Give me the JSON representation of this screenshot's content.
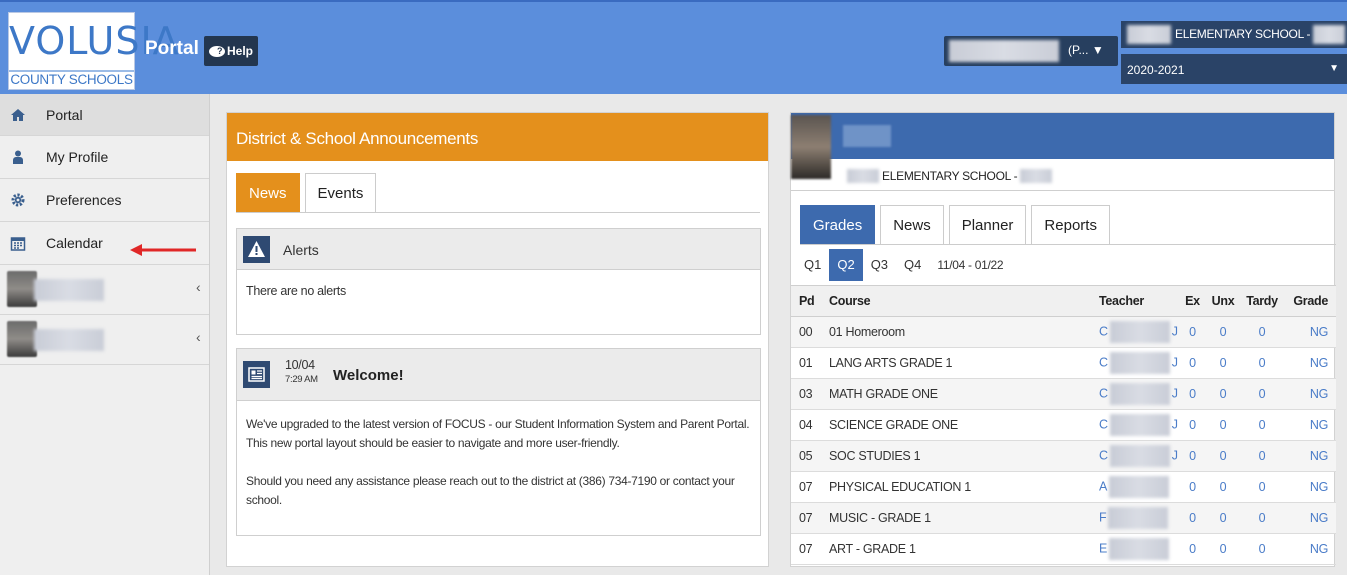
{
  "header": {
    "logo_text": "VOLUSIA",
    "logo_sub": "COUNTY SCHOOLS",
    "title": "Portal",
    "help": "Help",
    "user_select": "(P...",
    "school": "ELEMENTARY SCHOOL -",
    "year": "2020-2021"
  },
  "sidebar": {
    "items": [
      {
        "label": "Portal",
        "icon": "home-icon"
      },
      {
        "label": "My Profile",
        "icon": "user-icon"
      },
      {
        "label": "Preferences",
        "icon": "gear-icon"
      },
      {
        "label": "Calendar",
        "icon": "calendar-icon"
      }
    ]
  },
  "announcements": {
    "title": "District & School Announcements",
    "tabs": [
      "News",
      "Events"
    ],
    "alerts": {
      "title": "Alerts",
      "body": "There are no alerts"
    },
    "welcome": {
      "date": "10/04",
      "time": "7:29 AM",
      "title": "Welcome!",
      "p1": "We've upgraded to the latest version of FOCUS - our Student Information System and Parent Portal.",
      "p2": "This new portal layout should be easier to navigate and more user-friendly.",
      "p3": "Should you need any assistance please reach out to the district at (386) 734-7190 or contact your school."
    }
  },
  "student": {
    "school": "ELEMENTARY SCHOOL -",
    "tabs": [
      "Grades",
      "News",
      "Planner",
      "Reports"
    ],
    "quarters": [
      "Q1",
      "Q2",
      "Q3",
      "Q4"
    ],
    "range": "11/04 - 01/22",
    "columns": {
      "pd": "Pd",
      "course": "Course",
      "teacher": "Teacher",
      "ex": "Ex",
      "unx": "Unx",
      "tardy": "Tardy",
      "grade": "Grade"
    },
    "rows": [
      {
        "pd": "00",
        "course": "01 Homeroom",
        "t1": "C",
        "t2": "J",
        "ex": "0",
        "unx": "0",
        "tardy": "0",
        "grade": "NG"
      },
      {
        "pd": "01",
        "course": "LANG ARTS GRADE 1",
        "t1": "C",
        "t2": "J",
        "ex": "0",
        "unx": "0",
        "tardy": "0",
        "grade": "NG"
      },
      {
        "pd": "03",
        "course": "MATH GRADE ONE",
        "t1": "C",
        "t2": "J",
        "ex": "0",
        "unx": "0",
        "tardy": "0",
        "grade": "NG"
      },
      {
        "pd": "04",
        "course": "SCIENCE GRADE ONE",
        "t1": "C",
        "t2": "J",
        "ex": "0",
        "unx": "0",
        "tardy": "0",
        "grade": "NG"
      },
      {
        "pd": "05",
        "course": "SOC STUDIES 1",
        "t1": "C",
        "t2": "J",
        "ex": "0",
        "unx": "0",
        "tardy": "0",
        "grade": "NG"
      },
      {
        "pd": "07",
        "course": "PHYSICAL EDUCATION 1",
        "t1": "A",
        "t2": "",
        "ex": "0",
        "unx": "0",
        "tardy": "0",
        "grade": "NG"
      },
      {
        "pd": "07",
        "course": "MUSIC - GRADE 1",
        "t1": "F",
        "t2": "",
        "ex": "0",
        "unx": "0",
        "tardy": "0",
        "grade": "NG"
      },
      {
        "pd": "07",
        "course": "ART - GRADE 1",
        "t1": "E",
        "t2": "",
        "ex": "0",
        "unx": "0",
        "tardy": "0",
        "grade": "NG"
      }
    ]
  }
}
